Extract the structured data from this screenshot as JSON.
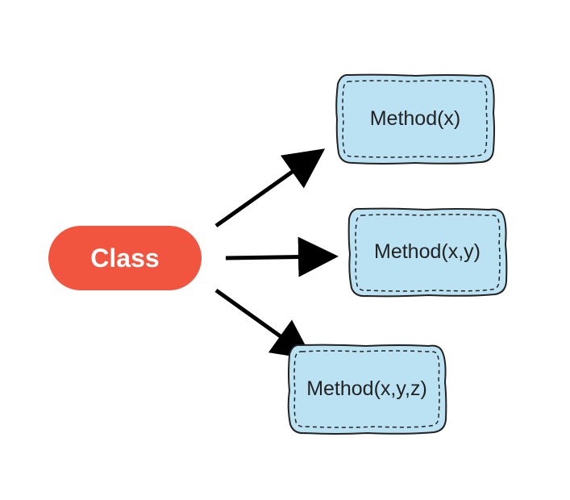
{
  "source": {
    "label": "Class"
  },
  "methods": [
    {
      "label": "Method(x)"
    },
    {
      "label": "Method(x,y)"
    },
    {
      "label": "Method(x,y,z)"
    }
  ]
}
